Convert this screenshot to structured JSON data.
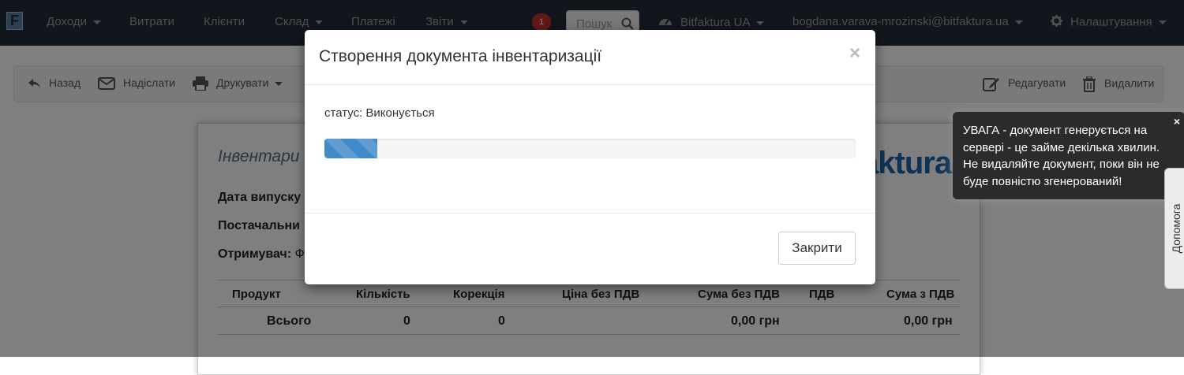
{
  "navbar": {
    "logo": "F",
    "items": {
      "income": "Доходи",
      "expenses": "Витрати",
      "clients": "Клієнти",
      "warehouse": "Склад",
      "payments": "Платежі",
      "reports": "Звіти"
    },
    "notifications_count": "1",
    "search_placeholder": "Пошук",
    "account": "Bitfaktura UA",
    "user_email": "bogdana.varava-mrozinski@bitfaktura.ua",
    "settings": "Налаштування"
  },
  "toolbar": {
    "back": "Назад",
    "send": "Надіслати",
    "print": "Друкувати",
    "edit": "Редагувати",
    "delete": "Видалити"
  },
  "document": {
    "title": "Інвентари",
    "brand": "aktura",
    "issue_date_label": "Дата випуску",
    "supplier_label": "Постачальни",
    "recipient_label": "Отримувач:",
    "recipient_value": "Ф",
    "table": {
      "headers": [
        "Продукт",
        "Кількість",
        "Корекція",
        "Ціна без ПДВ",
        "Сума без ПДВ",
        "ПДВ",
        "Сума з ПДВ"
      ],
      "total_row": [
        "Всього",
        "0",
        "0",
        "",
        "0,00 грн",
        "",
        "0,00 грн"
      ]
    }
  },
  "modal": {
    "title": "Створення документа інвентаризації",
    "close_symbol": "×",
    "status": "статус: Виконується",
    "progress": 0.1,
    "close_button": "Закрити"
  },
  "toast": {
    "message": "УВАГА - документ генерується на сервері - це займе декілька хвилин. Не видаляйте документ, поки він не буде повністю згенерований!",
    "close_symbol": "×"
  },
  "help_tab": "Допомога",
  "colors": {
    "navbar_bg": "#222d3b",
    "progress": "#428bca",
    "toast_bg": "#2b2b2b",
    "brand": "#1b67a8",
    "badge": "#c9302c"
  }
}
